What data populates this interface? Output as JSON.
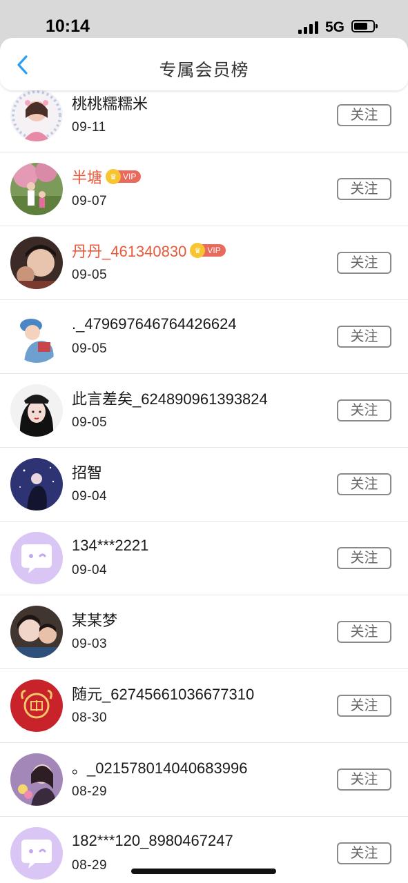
{
  "status_bar": {
    "time": "10:14",
    "network": "5G"
  },
  "header": {
    "title": "专属会员榜",
    "accent_color": "#2a9df4"
  },
  "follow_label": "关注",
  "vip_label": "VIP",
  "members": [
    {
      "name": "桃桃糯糯米",
      "date": "09-11",
      "vip": false,
      "avatar": "photo-woman-flower-frame"
    },
    {
      "name": "半塘",
      "date": "09-07",
      "vip": true,
      "avatar": "photo-tree-kids"
    },
    {
      "name": "丹丹_461340830",
      "date": "09-05",
      "vip": true,
      "avatar": "photo-woman-child"
    },
    {
      "name": "._479697646764426624",
      "date": "09-05",
      "vip": false,
      "avatar": "illustration-boy-hat"
    },
    {
      "name": "此言差矣_624890961393824",
      "date": "09-05",
      "vip": false,
      "avatar": "illustration-girl-cap"
    },
    {
      "name": "招智",
      "date": "09-04",
      "vip": false,
      "avatar": "illustration-night-sky"
    },
    {
      "name": "134***2221",
      "date": "09-04",
      "vip": false,
      "avatar": "default-chat-bubble"
    },
    {
      "name": "某某梦",
      "date": "09-03",
      "vip": false,
      "avatar": "photo-mother-child"
    },
    {
      "name": "随元_62745661036677310",
      "date": "08-30",
      "vip": false,
      "avatar": "red-fu-ox-emblem"
    },
    {
      "name": "。_021578014040683996",
      "date": "08-29",
      "vip": false,
      "avatar": "photo-girl-flowers"
    },
    {
      "name": "182***120_8980467247",
      "date": "08-29",
      "vip": false,
      "avatar": "default-chat-bubble"
    }
  ]
}
